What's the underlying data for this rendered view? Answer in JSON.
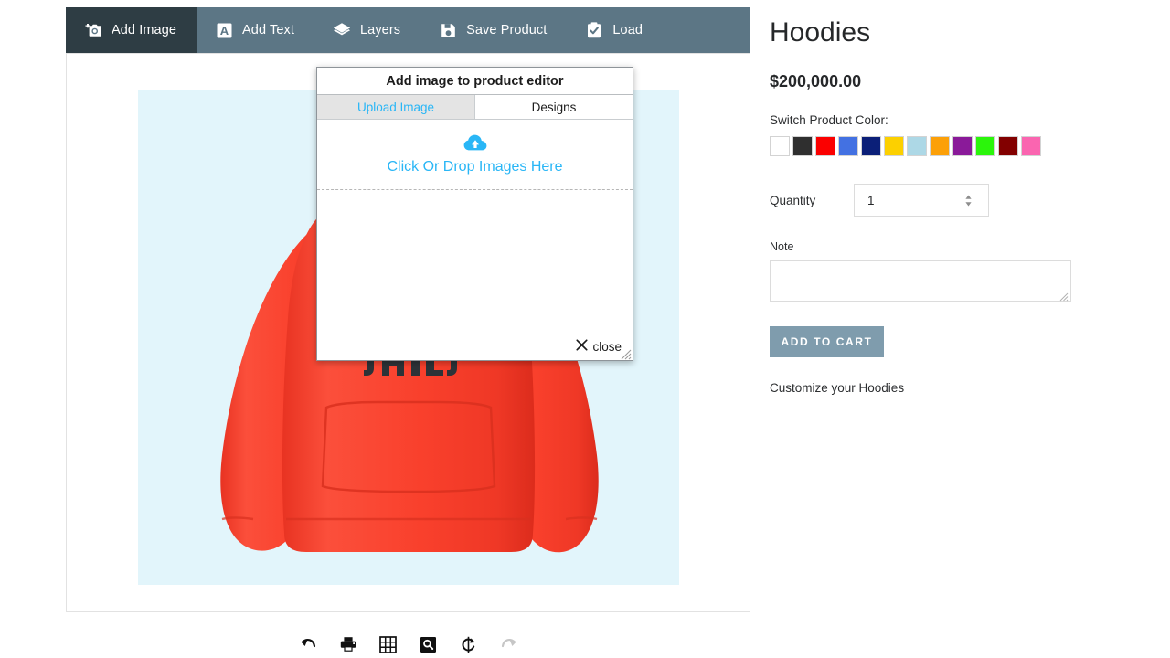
{
  "editor": {
    "toolbar": {
      "items": [
        {
          "label": "Add Image",
          "icon": "camera-add-icon",
          "active": true
        },
        {
          "label": "Add Text",
          "icon": "text-a-icon",
          "active": false
        },
        {
          "label": "Layers",
          "icon": "layers-icon",
          "active": false
        },
        {
          "label": "Save Product",
          "icon": "floppy-save-icon",
          "active": false
        },
        {
          "label": "Load",
          "icon": "clipboard-check-icon",
          "active": false
        }
      ],
      "background": "#5c7685",
      "active_background": "#2e3d44"
    },
    "canvas": {
      "stage_background": "#e2f5fb",
      "product_color": "#f9402c",
      "product_name": "Hoodies"
    },
    "bottom_tools": [
      {
        "name": "undo-icon",
        "enabled": true
      },
      {
        "name": "print-icon",
        "enabled": true
      },
      {
        "name": "grid-icon",
        "enabled": true
      },
      {
        "name": "zoom-icon",
        "enabled": true
      },
      {
        "name": "reset-icon",
        "enabled": true
      },
      {
        "name": "redo-icon",
        "enabled": false
      }
    ]
  },
  "modal": {
    "title": "Add image to product editor",
    "tabs": [
      {
        "label": "Upload Image",
        "active": true
      },
      {
        "label": "Designs",
        "active": false
      }
    ],
    "dropzone": {
      "icon": "cloud-upload-icon",
      "label": "Click Or Drop Images Here"
    },
    "close_label": "close",
    "close_icon": "close-x-icon",
    "accent_color": "#29b6f6"
  },
  "product": {
    "title": "Hoodies",
    "price": "$200,000.00",
    "color_label": "Switch Product Color:",
    "colors": [
      {
        "name": "white",
        "hex": "#ffffff",
        "selected": true
      },
      {
        "name": "black",
        "hex": "#2f2f2f",
        "selected": false
      },
      {
        "name": "red",
        "hex": "#fb0000",
        "selected": false
      },
      {
        "name": "royal-blue",
        "hex": "#4371e2",
        "selected": false
      },
      {
        "name": "navy",
        "hex": "#0b1f78",
        "selected": false
      },
      {
        "name": "yellow",
        "hex": "#fcd000",
        "selected": false
      },
      {
        "name": "light-blue",
        "hex": "#add8e6",
        "selected": false
      },
      {
        "name": "orange",
        "hex": "#fca008",
        "selected": false
      },
      {
        "name": "purple",
        "hex": "#8a1a99",
        "selected": false
      },
      {
        "name": "green",
        "hex": "#2bf50b",
        "selected": false
      },
      {
        "name": "maroon",
        "hex": "#820000",
        "selected": false
      },
      {
        "name": "pink",
        "hex": "#fa65b0",
        "selected": false
      }
    ],
    "quantity": {
      "label": "Quantity",
      "value": "1"
    },
    "note": {
      "label": "Note",
      "value": "",
      "placeholder": ""
    },
    "add_to_cart_label": "ADD TO CART",
    "add_to_cart_color": "#7f9cad",
    "customize_text": "Customize your Hoodies"
  }
}
